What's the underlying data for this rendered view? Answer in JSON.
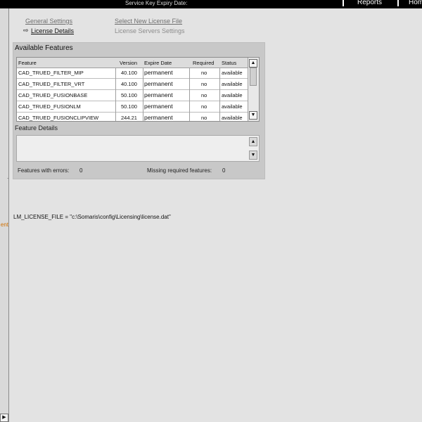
{
  "topbar": {
    "expiry_label": "Service Key Expiry Date:",
    "nav": [
      {
        "label": "Reports"
      },
      {
        "label": "Hom"
      }
    ]
  },
  "left_strip": {
    "fragment_text": "ent",
    "scroll_arrow": "▶"
  },
  "links": {
    "general_settings": "General Settings",
    "select_new_license": "Select New License File",
    "license_details": "License Details",
    "license_servers": "License Servers Settings"
  },
  "available_features": {
    "title": "Available Features",
    "columns": [
      "Feature",
      "Version",
      "Expire Date",
      "Required",
      "Status"
    ],
    "rows": [
      {
        "feature": "CAD_TRUED_FILTER_MIP",
        "version": "40.100",
        "expire": "permanent",
        "required": "no",
        "status": "available"
      },
      {
        "feature": "CAD_TRUED_FILTER_VRT",
        "version": "40.100",
        "expire": "permanent",
        "required": "no",
        "status": "available"
      },
      {
        "feature": "CAD_TRUED_FUSIONBASE",
        "version": "50.100",
        "expire": "permanent",
        "required": "no",
        "status": "available"
      },
      {
        "feature": "CAD_TRUED_FUSIONLM",
        "version": "50.100",
        "expire": "permanent",
        "required": "no",
        "status": "available"
      },
      {
        "feature": "CAD_TRUED_FUSIONCLIPVIEW",
        "version": "244.21",
        "expire": "permanent",
        "required": "no",
        "status": "available"
      },
      {
        "feature": "",
        "version": "",
        "expire": "",
        "required": "",
        "status": ""
      }
    ]
  },
  "feature_details": {
    "title": "Feature Details"
  },
  "stats": {
    "errors_label": "Features with errors:",
    "errors_value": "0",
    "missing_label": "Missing required features:",
    "missing_value": "0"
  },
  "license_file": "LM_LICENSE_FILE = \"c:\\Somaris\\config\\Licensing\\license.dat\"",
  "icons": {
    "arrow": "⇨",
    "scroll_up": "▲",
    "scroll_down": "▼",
    "detail_up": "▲",
    "detail_down": "▼"
  }
}
